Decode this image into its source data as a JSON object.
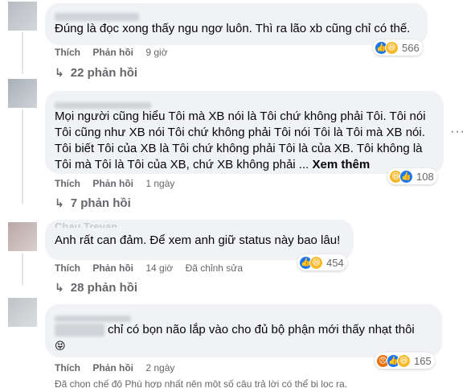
{
  "comments": [
    {
      "text": "Đúng là đọc xong thấy ngu ngơ luôn. Thì ra lão xb cũng chỉ có thế.",
      "like_label": "Thích",
      "reply_label": "Phản hồi",
      "time": "9 giờ",
      "reaction_count": "566",
      "reactions": [
        "like-icon",
        "haha-icon"
      ],
      "replies_label": "22 phản hồi"
    },
    {
      "text_lines": [
        "Mọi người cũng hiểu Tôi mà XB nói là Tôi chứ không phải Tôi. Tôi nói",
        "Tôi cũng như XB nói Tôi chứ không phải Tôi nói Tôi là Tôi mà XB nói.",
        "Tôi biết Tôi của XB là Tôi chứ không phải Tôi là của XB. Tôi không là",
        "Tôi mà Tôi là Tôi của XB, chứ XB không phải ... "
      ],
      "see_more": "Xem thêm",
      "like_label": "Thích",
      "reply_label": "Phản hồi",
      "time": "1 ngày",
      "reaction_count": "108",
      "reactions": [
        "haha-icon",
        "like-icon"
      ],
      "replies_label": "7 phản hồi",
      "more_icon": "···"
    },
    {
      "name_partial": "Chau Trevan",
      "text": "Anh rất can đảm. Để xem anh giữ status này bao lâu!",
      "like_label": "Thích",
      "reply_label": "Phản hồi",
      "time": "14 giờ",
      "edited": "Đã chỉnh sửa",
      "reaction_count": "454",
      "reactions": [
        "like-icon",
        "haha-icon"
      ],
      "replies_label": "28 phản hồi"
    },
    {
      "text": "chỉ có bọn não lắp vào cho đủ bộ phận mới thấy nhạt thôi",
      "emoji": "😝",
      "like_label": "Thích",
      "reply_label": "Phản hồi",
      "time": "2 ngày",
      "reaction_count": "165",
      "reactions": [
        "angry-icon",
        "like-icon",
        "haha-icon"
      ]
    }
  ],
  "filter_note": "Đã chọn chế độ Phù hợp nhất nên một số câu trả lời có thể bị lọc ra.",
  "colors": {
    "bubble": "#f0f2f5",
    "muted": "#65676b",
    "like": "#1877f2",
    "haha": "#f7b928",
    "angry": "#e9710f"
  }
}
